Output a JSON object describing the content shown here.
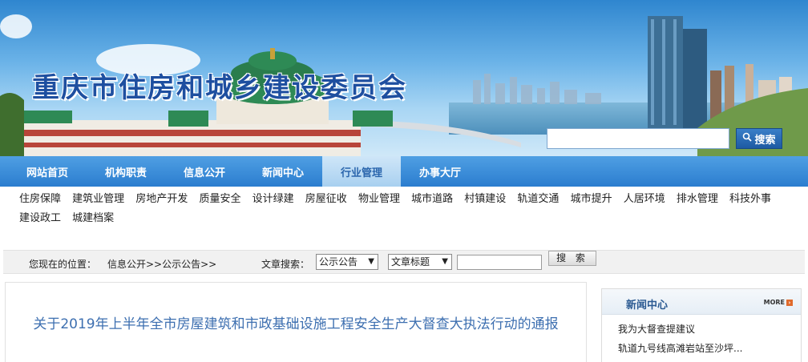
{
  "banner": {
    "title": "重庆市住房和城乡建设委员会",
    "search_placeholder": "",
    "search_button": "搜索"
  },
  "main_nav": {
    "items": [
      {
        "label": "网站首页"
      },
      {
        "label": "机构职责"
      },
      {
        "label": "信息公开"
      },
      {
        "label": "新闻中心"
      },
      {
        "label": "行业管理",
        "active": true
      },
      {
        "label": "办事大厅"
      }
    ]
  },
  "sub_nav": {
    "items": [
      {
        "label": "住房保障"
      },
      {
        "label": "建筑业管理"
      },
      {
        "label": "房地产开发"
      },
      {
        "label": "质量安全"
      },
      {
        "label": "设计绿建"
      },
      {
        "label": "房屋征收"
      },
      {
        "label": "物业管理"
      },
      {
        "label": "城市道路"
      },
      {
        "label": "村镇建设"
      },
      {
        "label": "轨道交通"
      },
      {
        "label": "城市提升"
      },
      {
        "label": "人居环境"
      },
      {
        "label": "排水管理"
      },
      {
        "label": "科技外事"
      },
      {
        "label": "建设政工"
      },
      {
        "label": "城建档案"
      }
    ]
  },
  "location_bar": {
    "label": "您现在的位置：",
    "path": "信息公开>>公示公告>>",
    "article_search_label": "文章搜索：",
    "category_select": "公示公告",
    "field_select": "文章标题",
    "keyword_value": "",
    "search_button": "搜 索"
  },
  "article": {
    "title": "关于2019年上半年全市房屋建筑和市政基础设施工程安全生产大督查大执法行动的通报"
  },
  "news": {
    "heading": "新闻中心",
    "more_label": "MORE",
    "items": [
      {
        "label": "我为大督查提建议"
      },
      {
        "label": "轨道九号线高滩岩站至沙坪..."
      }
    ]
  },
  "colors": {
    "nav_blue": "#2b7dcf",
    "title_blue": "#1e4fa0",
    "article_title": "#3d6fb0"
  }
}
